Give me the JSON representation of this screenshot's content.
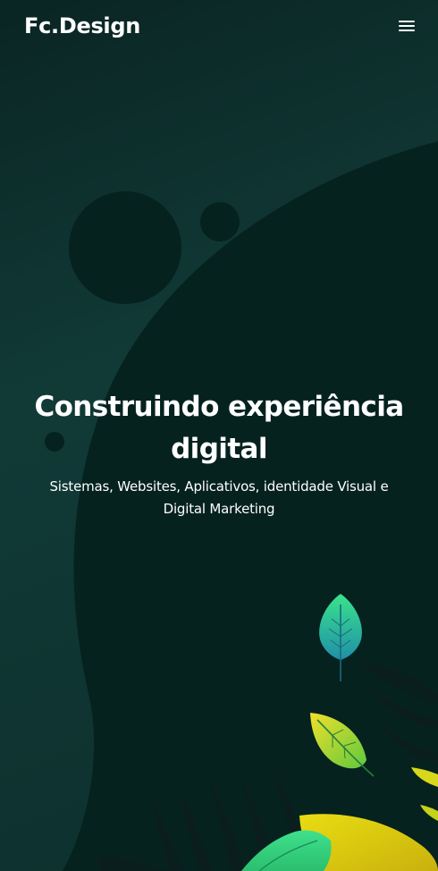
{
  "navbar": {
    "logo": "Fc.Design",
    "menu_icon": "hamburger-menu-icon"
  },
  "hero": {
    "title": "Construindo experiência digital",
    "subtitle": "Sistemas, Websites, Aplicativos, identidade Visual e Digital Marketing"
  },
  "colors": {
    "background": "#0b2a28",
    "blob": "#05201e",
    "leaf_green": "#2fd08a",
    "leaf_yellow": "#d8e21a",
    "text": "#ffffff"
  }
}
